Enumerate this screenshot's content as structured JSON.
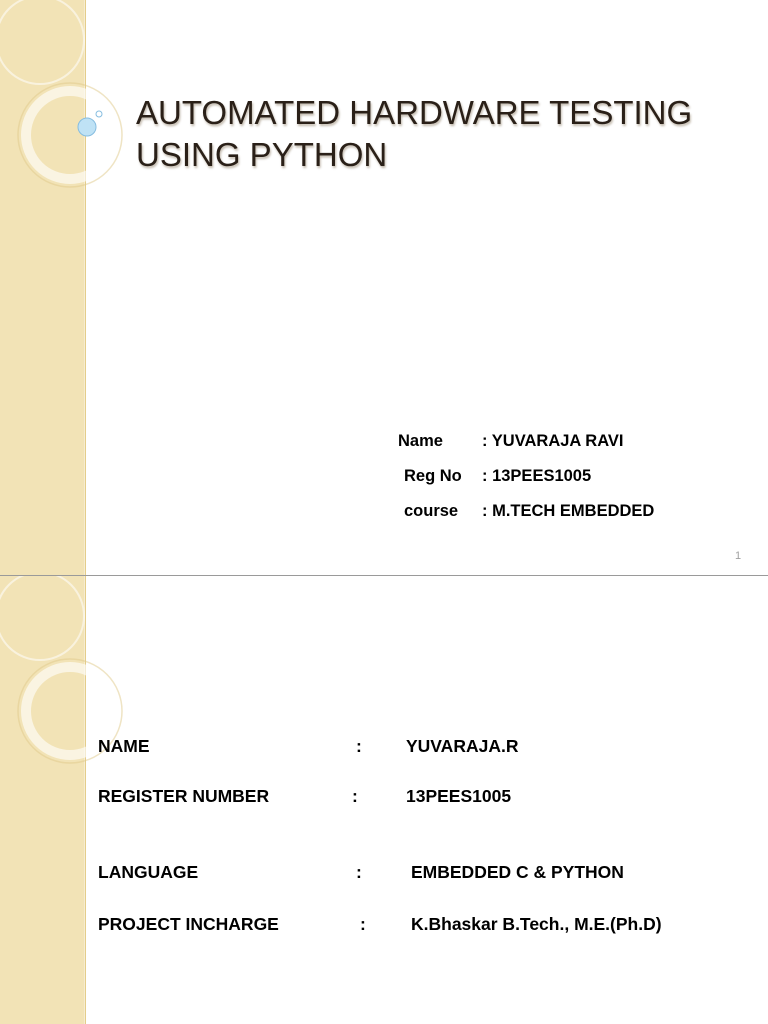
{
  "slides": [
    {
      "title_lines": [
        "AUTOMATED HARDWARE TESTING",
        "USING PYTHON"
      ],
      "info": [
        {
          "key": "Name",
          "value": ": YUVARAJA RAVI"
        },
        {
          "key": "Reg No",
          "value": ":  13PEES1005"
        },
        {
          "key": "course",
          "value": ":  M.TECH EMBEDDED"
        }
      ],
      "page_number": "1"
    },
    {
      "details": [
        {
          "label": "NAME",
          "sep": ":",
          "value": "YUVARAJA.R"
        },
        {
          "label": "REGISTER NUMBER",
          "sep": ":",
          "value": "13PEES1005"
        },
        {
          "label": "LANGUAGE",
          "sep": ":",
          "value": "EMBEDDED C & PYTHON"
        },
        {
          "label": "PROJECT  INCHARGE",
          "sep": ":",
          "value": "K.Bhaskar B.Tech., M.E.(Ph.D)"
        }
      ]
    }
  ],
  "colors": {
    "stripe": "#f2e3b6",
    "title_text": "#2a2018",
    "accent_bubble": "#a8d4ee"
  }
}
